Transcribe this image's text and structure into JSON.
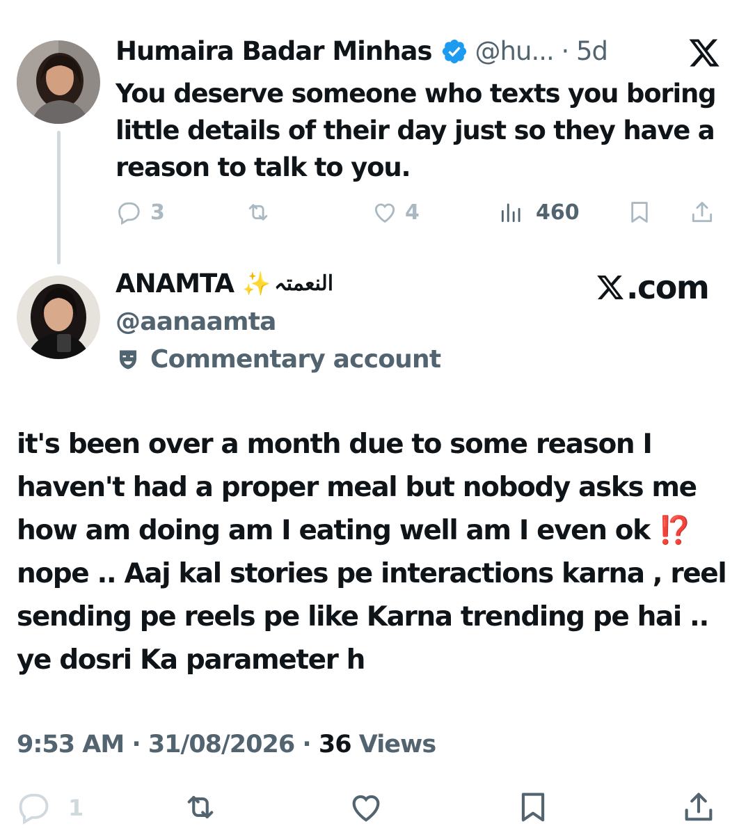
{
  "quoted_tweet": {
    "author_name": "Humaira Badar Minhas",
    "handle_time": "@hu... · 5d",
    "text": "You deserve someone who texts you boring little details of their day just so they have a reason to talk to you.",
    "replies": "3",
    "retweets": "",
    "likes": "4",
    "views": "460"
  },
  "main_tweet": {
    "author_name": "ANAMTA",
    "name_emoji": "✨",
    "name_arabic": "النعمتہ",
    "handle": "@aanaamta",
    "label": "Commentary account",
    "site": ".com",
    "text": "it's been over a month due to some reason I haven't had a proper meal but nobody asks me how am doing am I eating well am I even ok ⁉️ nope .. Aaj kal stories pe interactions karna , reel sending pe reels pe like Karna trending pe hai .. ye dosri Ka parameter h",
    "time_date": "9:53 AM · 31/08/2026 · ",
    "views_count": "36",
    "views_label": " Views",
    "reply_count": "1"
  },
  "colors": {
    "text": "#0f1419",
    "secondary": "#536471",
    "muted_icon": "#aab8c2",
    "verified": "#1d9bf0",
    "thread_line": "#cfd9de"
  }
}
